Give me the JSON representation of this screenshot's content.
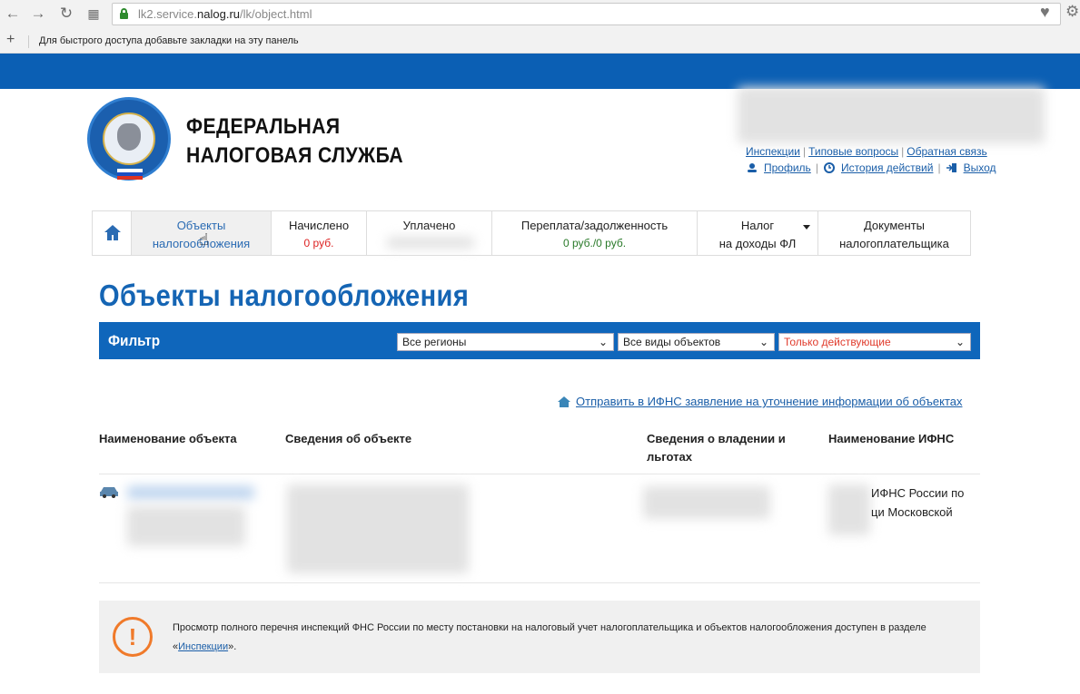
{
  "browser": {
    "url_prefix": "lk2.service.",
    "url_domain": "nalog.ru",
    "url_path": "/lk/object.html",
    "bookmarks_hint": "Для быстрого доступа добавьте закладки на эту панель"
  },
  "header": {
    "org_line1": "ФЕДЕРАЛЬНАЯ",
    "org_line2": "НАЛОГОВАЯ СЛУЖБА",
    "emblem_text": "ФЕДЕРАЛЬНАЯ НАЛОГОВАЯ СЛУЖБА",
    "links_row1": [
      "Инспекции",
      "Типовые вопросы",
      "Обратная связь"
    ],
    "links_row2": [
      "Профиль",
      "История действий",
      "Выход"
    ]
  },
  "tabs": [
    {
      "line1": "Объекты",
      "line2": "налогообложения"
    },
    {
      "line1": "Начислено",
      "line2": "0 руб."
    },
    {
      "line1": "Уплачено",
      "line2": ""
    },
    {
      "line1": "Переплата/задолженность",
      "line2": "0 руб./0 руб."
    },
    {
      "line1": "Налог",
      "line2": "на доходы ФЛ"
    },
    {
      "line1": "Документы",
      "line2": "налогоплательщика"
    }
  ],
  "page_title": "Объекты налогообложения",
  "filter": {
    "label": "Фильтр",
    "region": "Все регионы",
    "object_type": "Все виды объектов",
    "status": "Только действующие"
  },
  "send_link": "Отправить в ИФНС заявление на уточнение информации об объектах",
  "table": {
    "headers": [
      "Наименование объекта",
      "Сведения об объекте",
      "Сведения о владении и льготах",
      "Наименование ИФНС"
    ],
    "row_ifns_line1": "ИФНС России по",
    "row_ifns_line2": "ци Московской"
  },
  "notice": {
    "text": "Просмотр полного перечня инспекций ФНС России по месту постановки на налоговый учет налогоплательщика и объектов налогообложения доступен в разделе «",
    "link": "Инспекции",
    "tail": "»."
  },
  "colors": {
    "brand_blue": "#0b5fb4",
    "title_blue": "#1565b4",
    "link_blue": "#1a5ea8",
    "warning_orange": "#f07a2a",
    "warning_red": "#e03a2b"
  }
}
